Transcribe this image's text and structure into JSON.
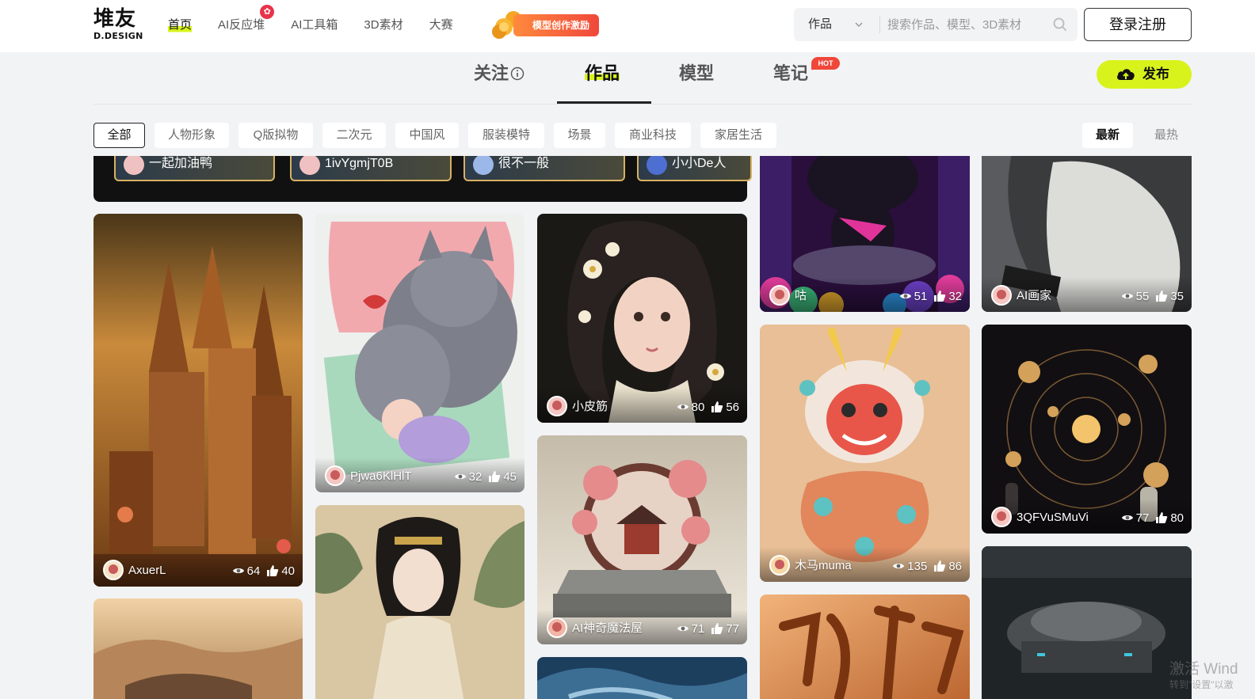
{
  "logo": {
    "text_cn": "堆友",
    "text_en": "D.DESIGN"
  },
  "nav": {
    "items": [
      {
        "label": "首页",
        "active": true
      },
      {
        "label": "AI反应堆",
        "badge": "✿"
      },
      {
        "label": "AI工具箱"
      },
      {
        "label": "3D素材"
      },
      {
        "label": "大赛"
      }
    ],
    "promo_label": "模型创作激励"
  },
  "search": {
    "category": "作品",
    "placeholder": "搜索作品、模型、3D素材"
  },
  "login_label": "登录注册",
  "tabs": [
    {
      "label": "关注",
      "info_icon": "info-icon"
    },
    {
      "label": "作品",
      "active": true
    },
    {
      "label": "模型"
    },
    {
      "label": "笔记",
      "badge": "HOT"
    }
  ],
  "publish_label": "发布",
  "filters": [
    "全部",
    "人物形象",
    "Q版拟物",
    "二次元",
    "中国风",
    "服装模特",
    "场景",
    "商业科技",
    "家居生活"
  ],
  "sort": {
    "newest": "最新",
    "hottest": "最热"
  },
  "strip_users": [
    "一起加油鸭",
    "1ivYgmjT0B",
    "很不一般",
    "小小De人"
  ],
  "cards": {
    "c1": {
      "user": "AxuerL",
      "views": "64",
      "likes": "40"
    },
    "c2": {
      "user": "Pjwa6KlHlT",
      "views": "32",
      "likes": "45"
    },
    "c3": {
      "user": "小皮筋",
      "views": "80",
      "likes": "56"
    },
    "c4": {
      "user": "AI神奇魔法屋",
      "views": "71",
      "likes": "77"
    },
    "c5": {
      "user": "咕",
      "views": "51",
      "likes": "32"
    },
    "c6": {
      "user": "木马muma",
      "views": "135",
      "likes": "86"
    },
    "c7": {
      "user": "AI画家",
      "views": "55",
      "likes": "35"
    },
    "c8": {
      "user": "3QFVuSMuVi",
      "views": "77",
      "likes": "80"
    }
  },
  "watermark": {
    "line1": "激活 Wind",
    "line2": "转到\"设置\"以激"
  },
  "colors": {
    "accent": "#d8f31c",
    "hot": "#f0473b",
    "text": "#222222"
  }
}
